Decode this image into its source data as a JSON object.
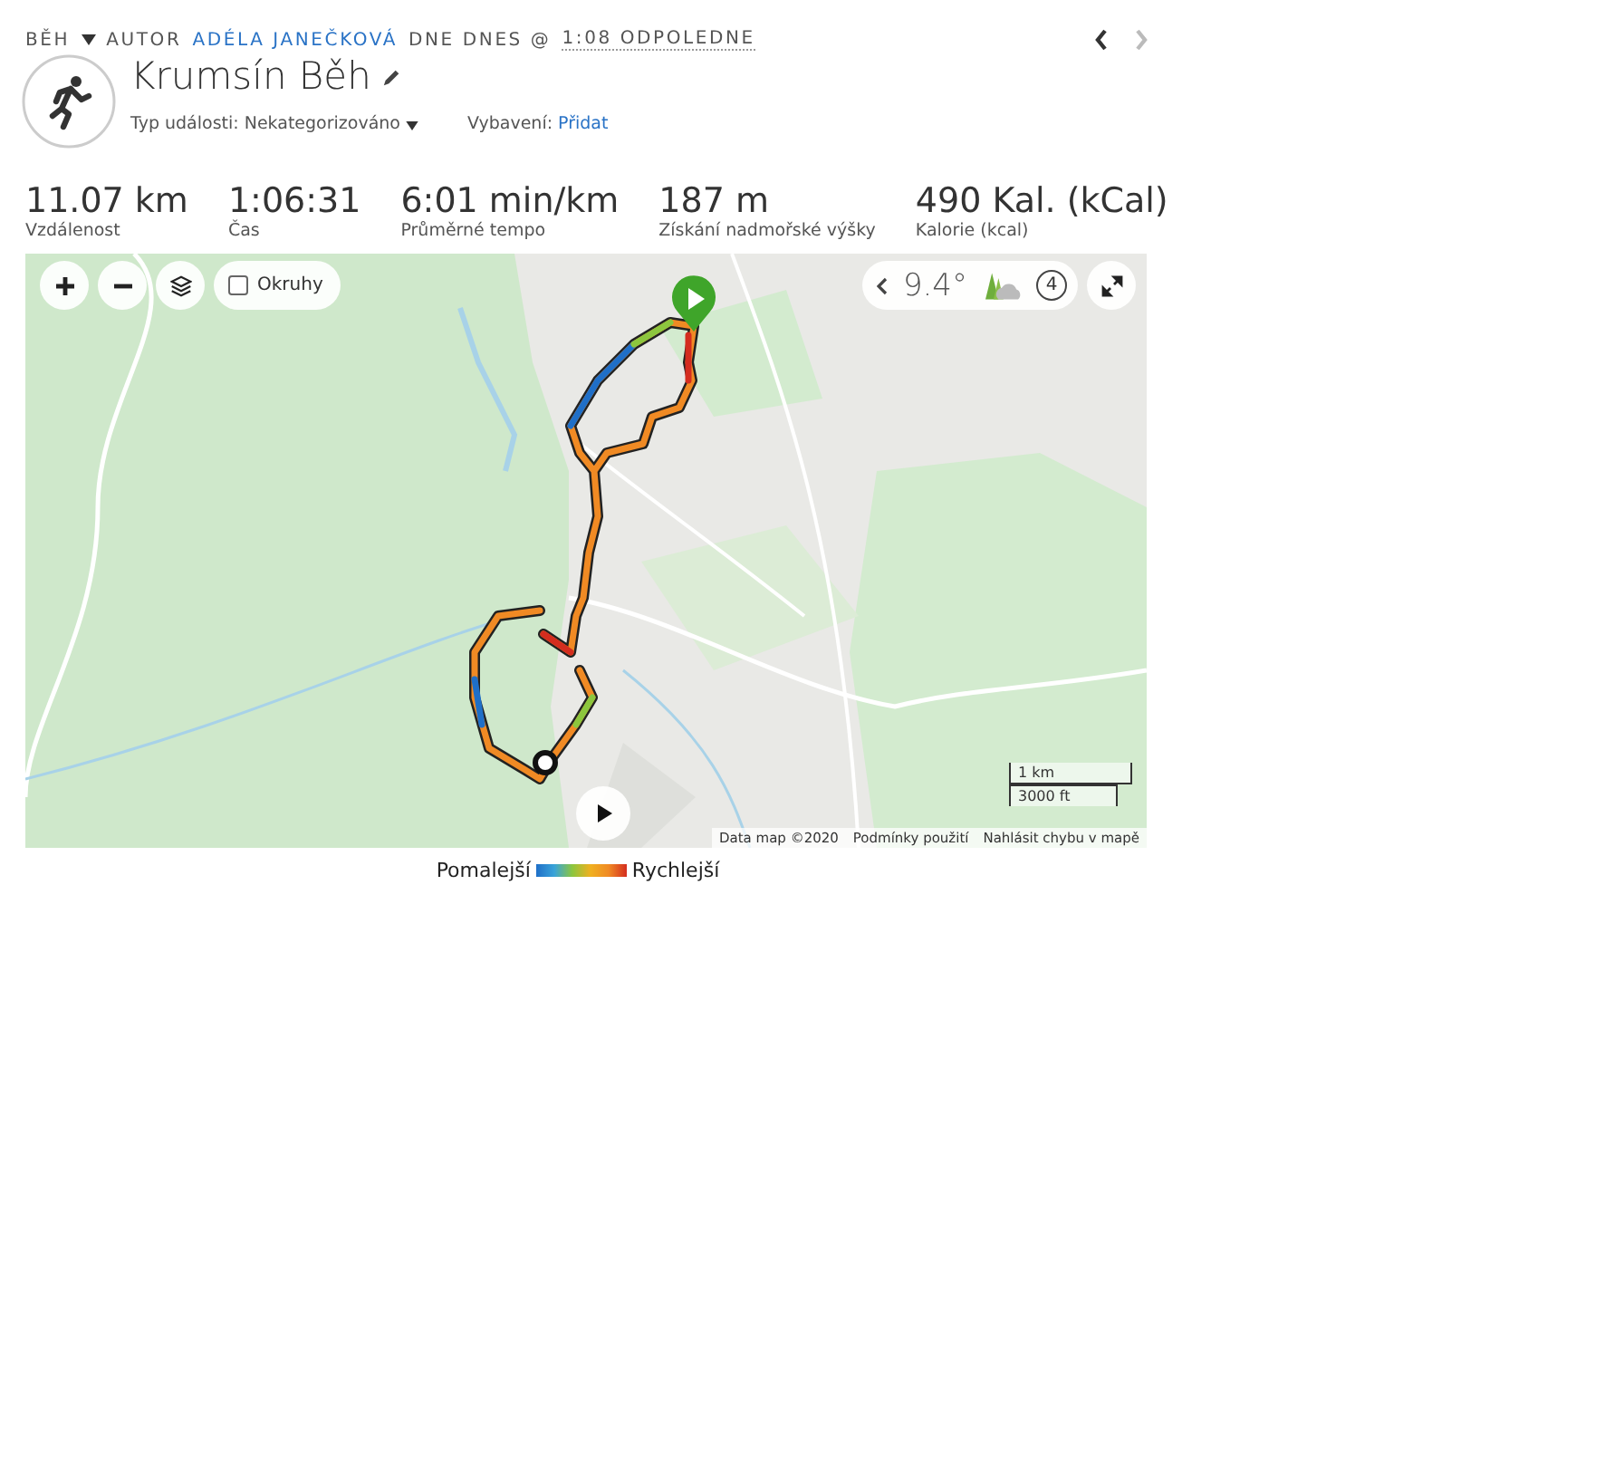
{
  "header": {
    "activity": "BĚH",
    "author_prefix": "AUTOR",
    "author": "ADÉLA JANEČKOVÁ",
    "date_prefix": "DNE DNES @",
    "time": "1:08 ODPOLEDNE"
  },
  "title": "Krumsín Běh",
  "event_type": {
    "label": "Typ události:",
    "value": "Nekategorizováno"
  },
  "equipment": {
    "label": "Vybavení:",
    "link": "Přidat"
  },
  "stats": [
    {
      "value": "11.07 km",
      "label": "Vzdálenost"
    },
    {
      "value": "1:06:31",
      "label": "Čas"
    },
    {
      "value": "6:01 min/km",
      "label": "Průměrné tempo"
    },
    {
      "value": "187 m",
      "label": "Získání nadmořské výšky"
    },
    {
      "value": "490 Kal. (kCal)",
      "label": "Kalorie (kcal)"
    }
  ],
  "map": {
    "laps_toggle": {
      "label": "Okruhy",
      "checked": false
    },
    "temperature": "9.4°",
    "laps": "4",
    "scale": [
      "1 km",
      "3000 ft"
    ],
    "attribution": [
      "Data map ©2020",
      "Podmínky použití",
      "Nahlásit chybu v mapě"
    ]
  },
  "legend": {
    "slower": "Pomalejší",
    "faster": "Rychlejší"
  }
}
